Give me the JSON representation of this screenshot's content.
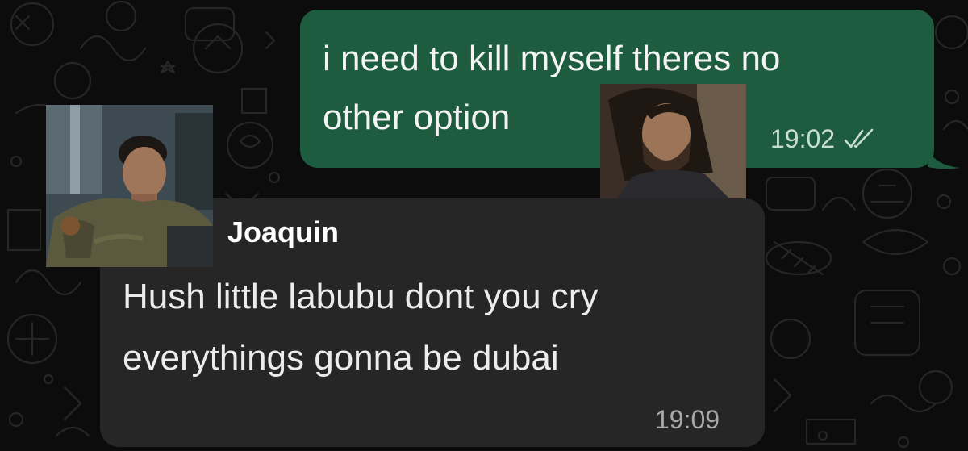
{
  "conversation": {
    "outgoing": {
      "lines": [
        "i need to kill myself theres no",
        "other option"
      ],
      "time": "19:02",
      "status_icon": "double-check-icon"
    },
    "incoming": {
      "sender": "Joaquin",
      "lines": [
        "Hush little labubu dont you cry",
        "everythings gonna be dubai"
      ],
      "time": "19:09"
    }
  },
  "colors": {
    "background": "#0c0c0c",
    "outgoing_bubble": "#1d5c3e",
    "incoming_bubble": "#262626",
    "text": "#f4f4f4"
  }
}
